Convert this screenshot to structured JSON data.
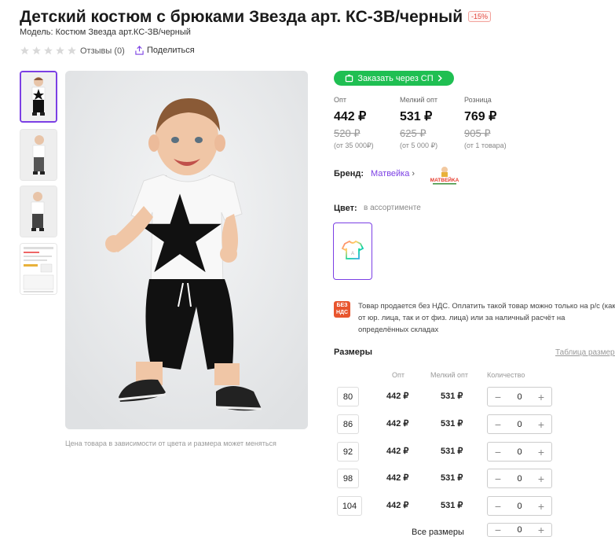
{
  "product": {
    "title": "Детский костюм с брюками Звезда арт. КС-ЗВ/черный",
    "discount_badge": "-15%",
    "model": "Модель: Костюм Звезда арт.КС-ЗВ/черный",
    "reviews": "Отзывы (0)",
    "share": "Поделиться",
    "rating": 0,
    "rating_max": 5,
    "price_note": "Цена товара в зависимости от цвета и размера может меняться"
  },
  "purchase": {
    "sp_button": "Заказать через СП",
    "accent_color": "#1fbf52",
    "prices": [
      {
        "label": "Опт",
        "price": "442 ₽",
        "old_price": "520 ₽",
        "note": "(от 35 000₽)"
      },
      {
        "label": "Мелкий опт",
        "price": "531 ₽",
        "old_price": "625 ₽",
        "note": "(от 5 000 ₽)"
      },
      {
        "label": "Розница",
        "price": "769 ₽",
        "old_price": "905 ₽",
        "note": "(от 1 товара)"
      }
    ]
  },
  "brand": {
    "label": "Бренд:",
    "name": "Матвейка",
    "logo_text": "MATBEЙKA",
    "link_color": "#7b3fe4"
  },
  "color": {
    "label": "Цвет:",
    "value": "в ассортименте"
  },
  "vat": {
    "badge": "БЕЗ НДС",
    "text": "Товар продается без НДС. Оплатить такой товар можно только на р/с (как от юр. лица, так и от физ. лица) или за наличный расчёт на определённых складах"
  },
  "sizes": {
    "label": "Размеры",
    "table_link": "Таблица размеров",
    "headers": {
      "opt": "Опт",
      "small_opt": "Мелкий опт",
      "qty": "Количество"
    },
    "rows": [
      {
        "size": "80",
        "opt": "442 ₽",
        "small_opt": "531 ₽",
        "qty": "0"
      },
      {
        "size": "86",
        "opt": "442 ₽",
        "small_opt": "531 ₽",
        "qty": "0"
      },
      {
        "size": "92",
        "opt": "442 ₽",
        "small_opt": "531 ₽",
        "qty": "0"
      },
      {
        "size": "98",
        "opt": "442 ₽",
        "small_opt": "531 ₽",
        "qty": "0"
      },
      {
        "size": "104",
        "opt": "442 ₽",
        "small_opt": "531 ₽",
        "qty": "0"
      }
    ],
    "all_sizes_label": "Все размеры",
    "all_sizes_qty": "0"
  },
  "stepper": {
    "minus": "−",
    "plus": "+"
  }
}
